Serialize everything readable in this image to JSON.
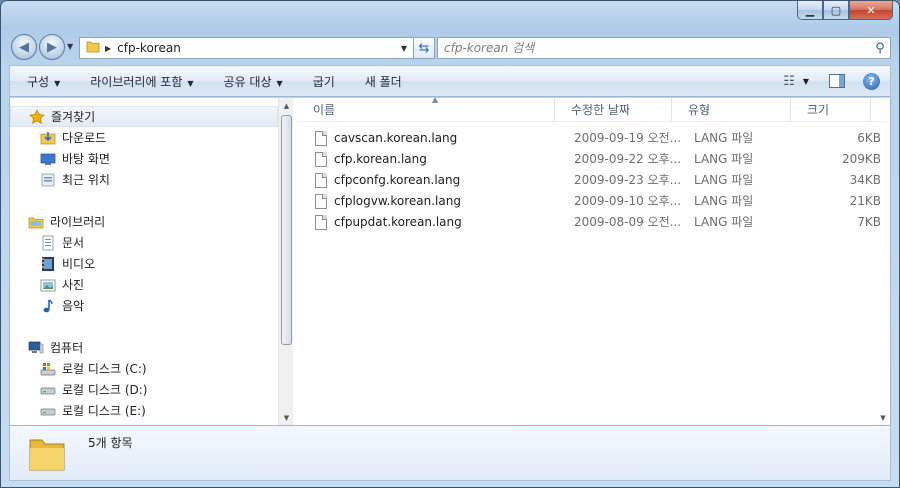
{
  "window": {
    "minimize_glyph": "▁",
    "maximize_glyph": "▢",
    "close_glyph": "✕"
  },
  "address": {
    "path": "cfp-korean",
    "search_placeholder": "cfp-korean 검색"
  },
  "toolbar": {
    "items": [
      "구성",
      "라이브러리에 포함",
      "공유 대상",
      "굽기",
      "새 폴더"
    ]
  },
  "nav": {
    "favorites": {
      "label": "즐겨찾기",
      "items": [
        "다운로드",
        "바탕 화면",
        "최근 위치"
      ]
    },
    "libraries": {
      "label": "라이브러리",
      "items": [
        "문서",
        "비디오",
        "사진",
        "음악"
      ]
    },
    "computer": {
      "label": "컴퓨터",
      "items": [
        "로컬 디스크 (C:)",
        "로컬 디스크 (D:)",
        "로컬 디스크 (E:)"
      ]
    }
  },
  "columns": {
    "name": "이름",
    "modified": "수정한 날짜",
    "type": "유형",
    "size": "크기"
  },
  "files": [
    {
      "name": "cavscan.korean.lang",
      "modified": "2009-09-19 오전...",
      "type": "LANG 파일",
      "size": "6KB"
    },
    {
      "name": "cfp.korean.lang",
      "modified": "2009-09-22 오후...",
      "type": "LANG 파일",
      "size": "209KB"
    },
    {
      "name": "cfpconfg.korean.lang",
      "modified": "2009-09-23 오후...",
      "type": "LANG 파일",
      "size": "34KB"
    },
    {
      "name": "cfplogvw.korean.lang",
      "modified": "2009-09-10 오후...",
      "type": "LANG 파일",
      "size": "21KB"
    },
    {
      "name": "cfpupdat.korean.lang",
      "modified": "2009-08-09 오전...",
      "type": "LANG 파일",
      "size": "7KB"
    }
  ],
  "status": {
    "item_count": "5개 항목"
  },
  "colors": {
    "folder": "#f2c94c",
    "star": "#f0b400",
    "selected_bg": "#e3ebf4"
  }
}
